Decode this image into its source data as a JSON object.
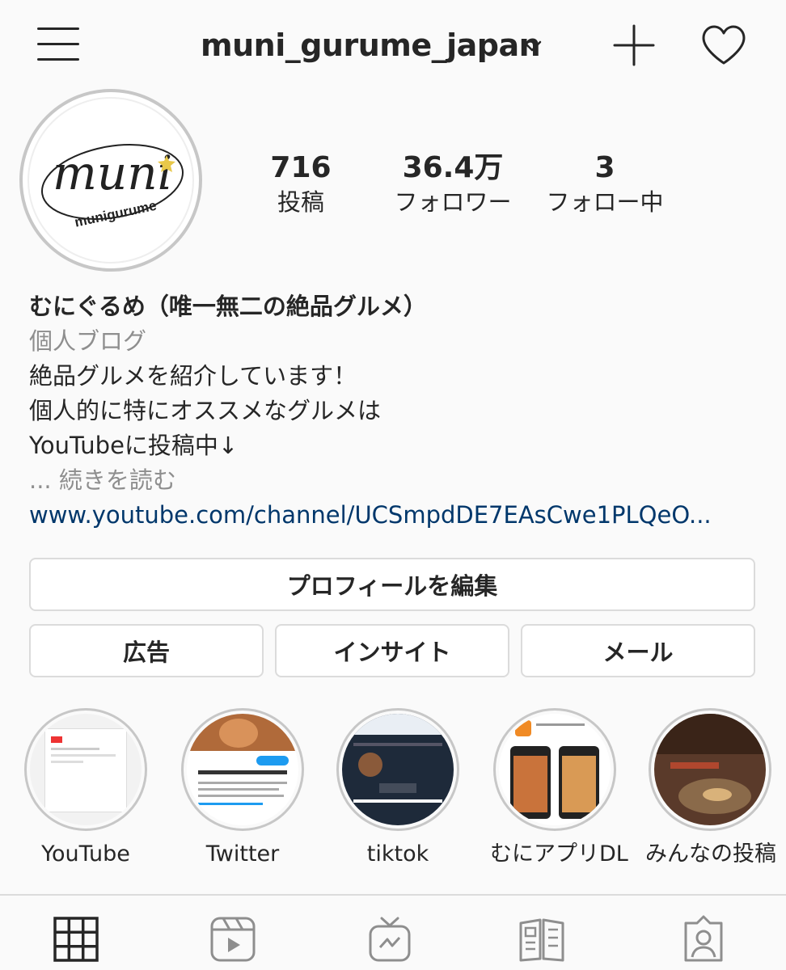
{
  "header": {
    "username": "muni_gurume_japan",
    "menu_icon": "hamburger-menu-icon",
    "dropdown_icon": "chevron-down-icon",
    "new_post_icon": "plus-icon",
    "activity_icon": "heart-icon"
  },
  "profile": {
    "avatar_logo_text": "muni",
    "avatar_logo_sub": "munigurume",
    "stats": {
      "posts_count": "716",
      "posts_label": "投稿",
      "followers_count": "36.4万",
      "followers_label": "フォロワー",
      "following_count": "3",
      "following_label": "フォロー中"
    },
    "bio": {
      "display_name": "むにぐるめ（唯一無二の絶品グルメ）",
      "category": "個人ブログ",
      "line1": "絶品グルメを紹介しています！",
      "line2": "個人的に特にオススメなグルメは",
      "line3": "YouTubeに投稿中↓",
      "more": "... 続きを読む",
      "link": "www.youtube.com/channel/UCSmpdDE7EAsCwe1PLQeO..."
    }
  },
  "buttons": {
    "edit_profile": "プロフィールを編集",
    "ads": "広告",
    "insights": "インサイト",
    "email": "メール"
  },
  "highlights": [
    {
      "label": "YouTube"
    },
    {
      "label": "Twitter"
    },
    {
      "label": "tiktok"
    },
    {
      "label": "むにアプリDL"
    },
    {
      "label": "みんなの投稿"
    }
  ],
  "tabs": [
    "grid-icon",
    "reels-icon",
    "igtv-icon",
    "guides-icon",
    "tagged-icon"
  ],
  "colors": {
    "text": "#262626",
    "secondary": "#8e8e8e",
    "link": "#00376b",
    "border": "#dbdbdb",
    "background": "#fafafa"
  }
}
